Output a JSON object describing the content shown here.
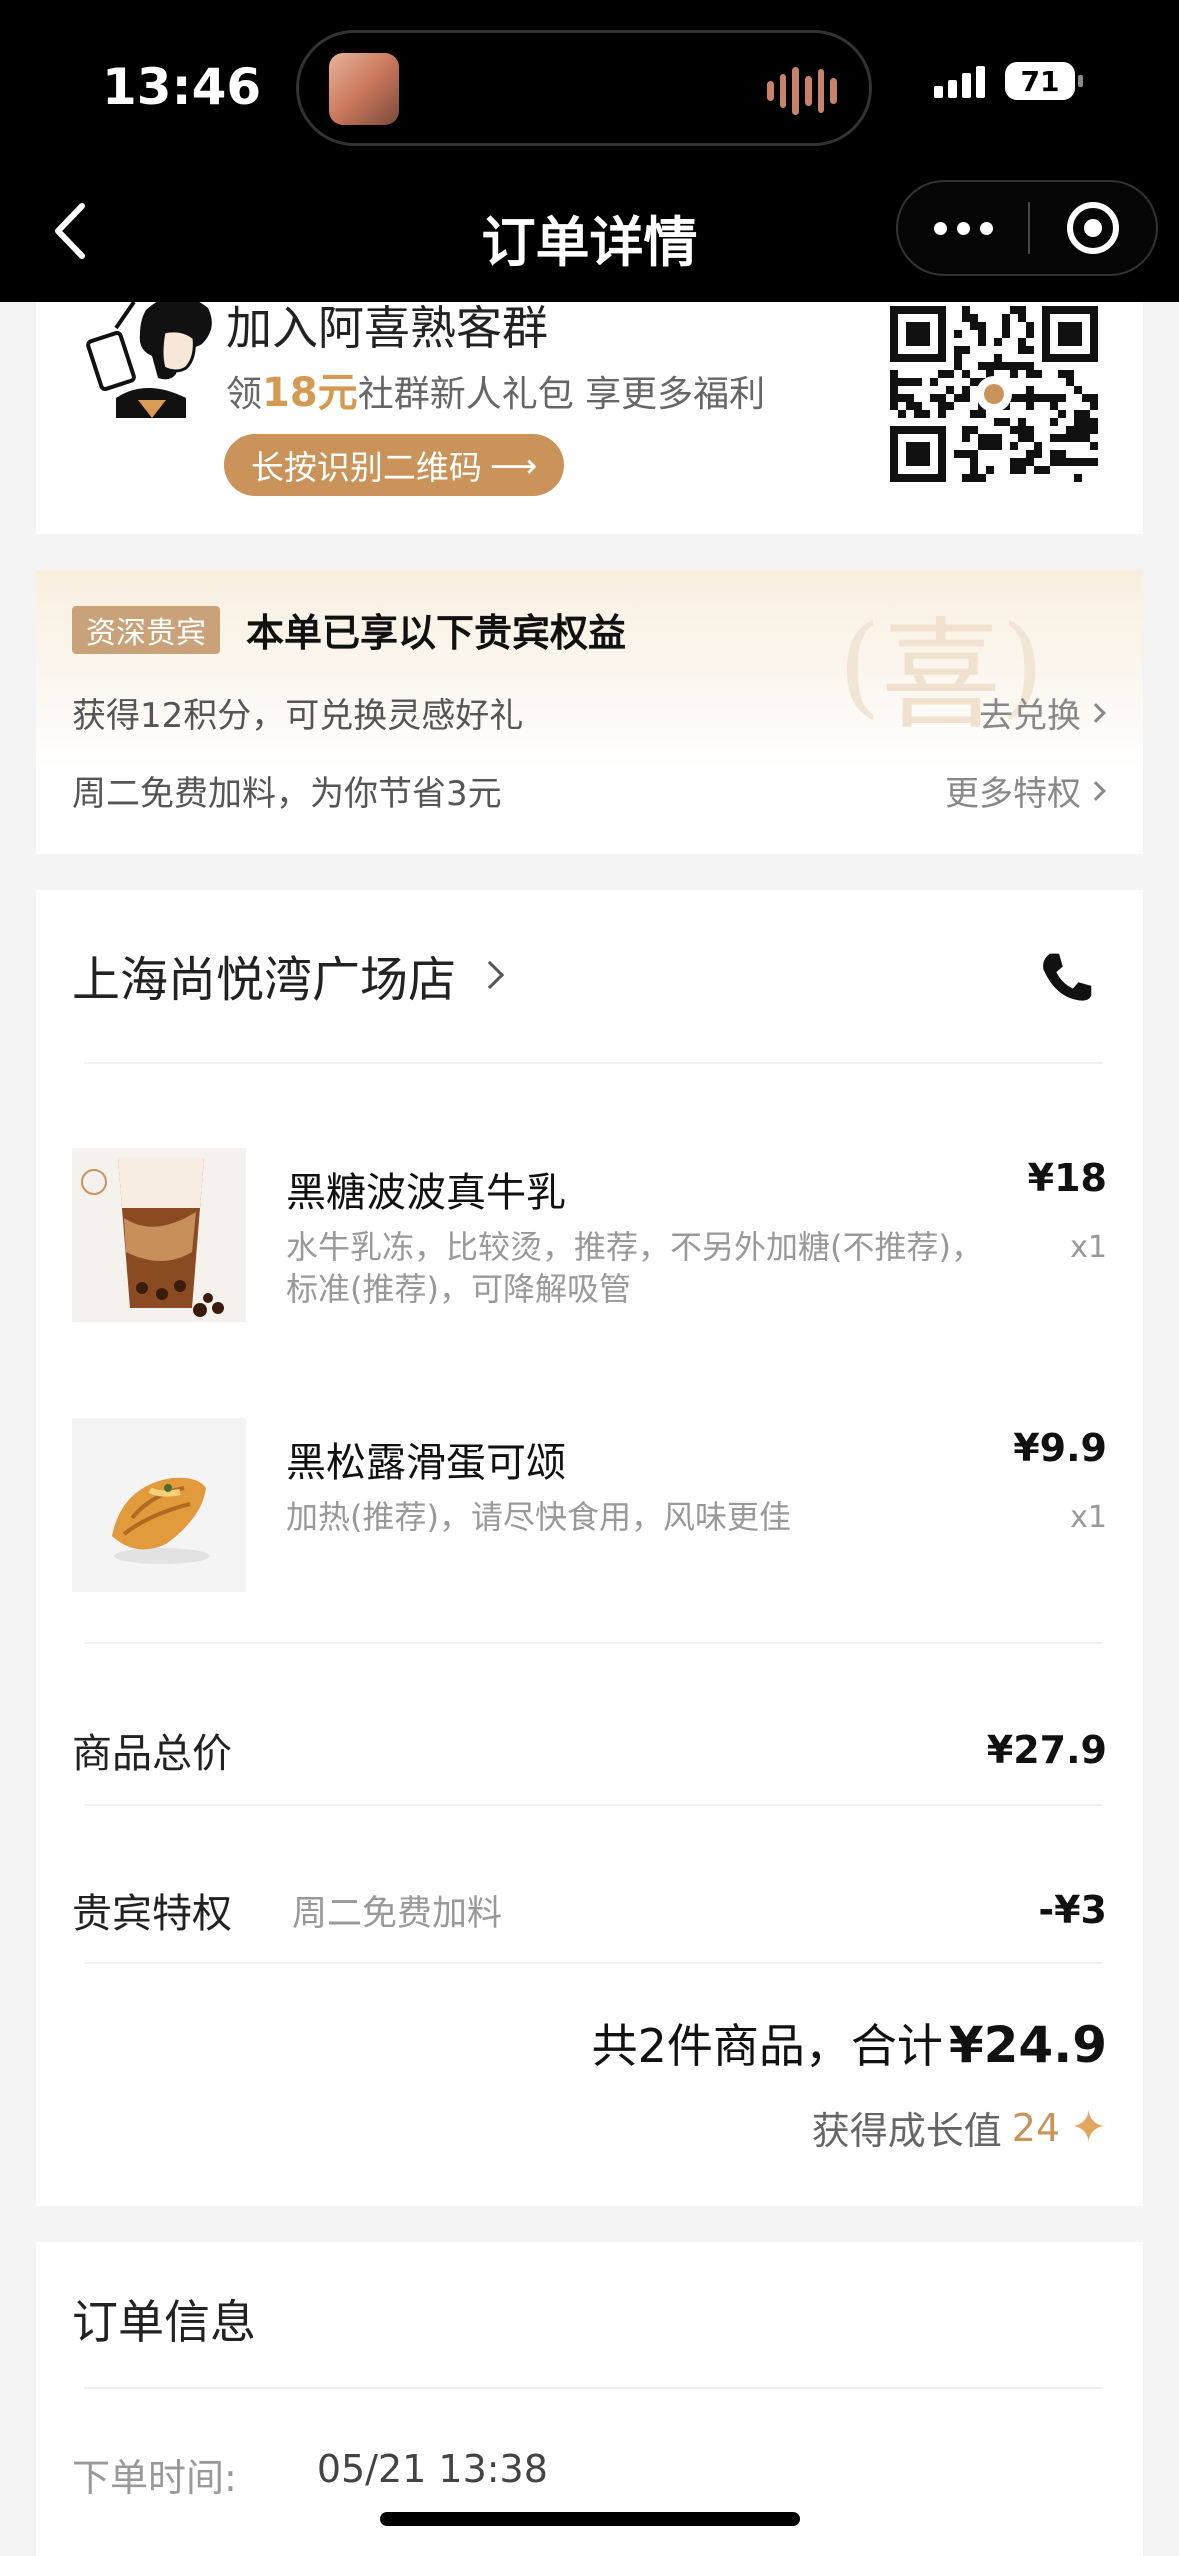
{
  "status_bar": {
    "time": "13:46",
    "battery": "71"
  },
  "nav": {
    "title": "订单详情"
  },
  "community": {
    "title": "加入阿喜熟客群",
    "subtitle_pre": "领",
    "subtitle_amount": "18元",
    "subtitle_post": "社群新人礼包 享更多福利",
    "button_label": "长按识别二维码",
    "button_arrow": "⟶"
  },
  "vip": {
    "tag": "资深贵宾",
    "title": "本单已享以下贵宾权益",
    "seal": "喜",
    "rows": [
      {
        "text": "获得12积分，可兑换灵感好礼",
        "link": "去兑换"
      },
      {
        "text": "周二免费加料，为你节省3元",
        "link": "更多特权"
      }
    ]
  },
  "order": {
    "store_name": "上海尚悦湾广场店",
    "items": [
      {
        "name": "黑糖波波真牛乳",
        "options": "水牛乳冻，比较烫，推荐，不另外加糖(不推荐)，标准(推荐)，可降解吸管",
        "price": "¥18",
        "qty": "x1",
        "image": "brown-sugar-milk-cup"
      },
      {
        "name": "黑松露滑蛋可颂",
        "options": "加热(推荐)，请尽快食用，风味更佳",
        "price": "¥9.9",
        "qty": "x1",
        "image": "truffle-croissant"
      }
    ],
    "subtotal_label": "商品总价",
    "subtotal_value": "¥27.9",
    "discount_label": "贵宾特权",
    "discount_note": "周二免费加料",
    "discount_value": "-¥3",
    "total_prefix": "共2件商品，合计",
    "total_value": "¥24.9",
    "growth_label": "获得成长值",
    "growth_value": "24",
    "growth_icon": "✦"
  },
  "info": {
    "title": "订单信息",
    "rows": [
      {
        "label": "下单时间:",
        "value": "05/21 13:38"
      }
    ]
  },
  "colors": {
    "accent_gold": "#c9935a",
    "amount_gold": "#d59a52",
    "vip_tag": "#c9a27a"
  }
}
